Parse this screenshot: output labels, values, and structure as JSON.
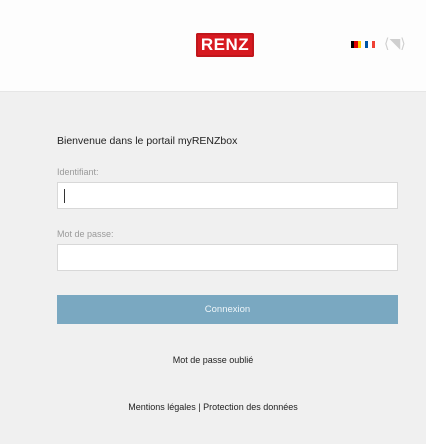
{
  "header": {
    "logo_text": "RENZ",
    "logo_color": "#d71920",
    "languages": [
      {
        "icon": "german-flag-icon",
        "colors": [
          "#000000",
          "#dd0000",
          "#ffce00"
        ]
      },
      {
        "icon": "french-flag-icon",
        "colors": [
          "#0055a4",
          "#ffffff",
          "#ef4135"
        ]
      }
    ]
  },
  "login": {
    "welcome": "Bienvenue dans le portail myRENZbox",
    "username_label": "Identifiant:",
    "username_value": "",
    "password_label": "Mot de passe:",
    "password_value": "",
    "connect_label": "Connexion",
    "connect_color": "#7aa8c1"
  },
  "footer": {
    "forgot_password": "Mot de passe oublié",
    "legal_notice": "Mentions légales",
    "separator": "|",
    "data_protection": "Protection des données"
  }
}
